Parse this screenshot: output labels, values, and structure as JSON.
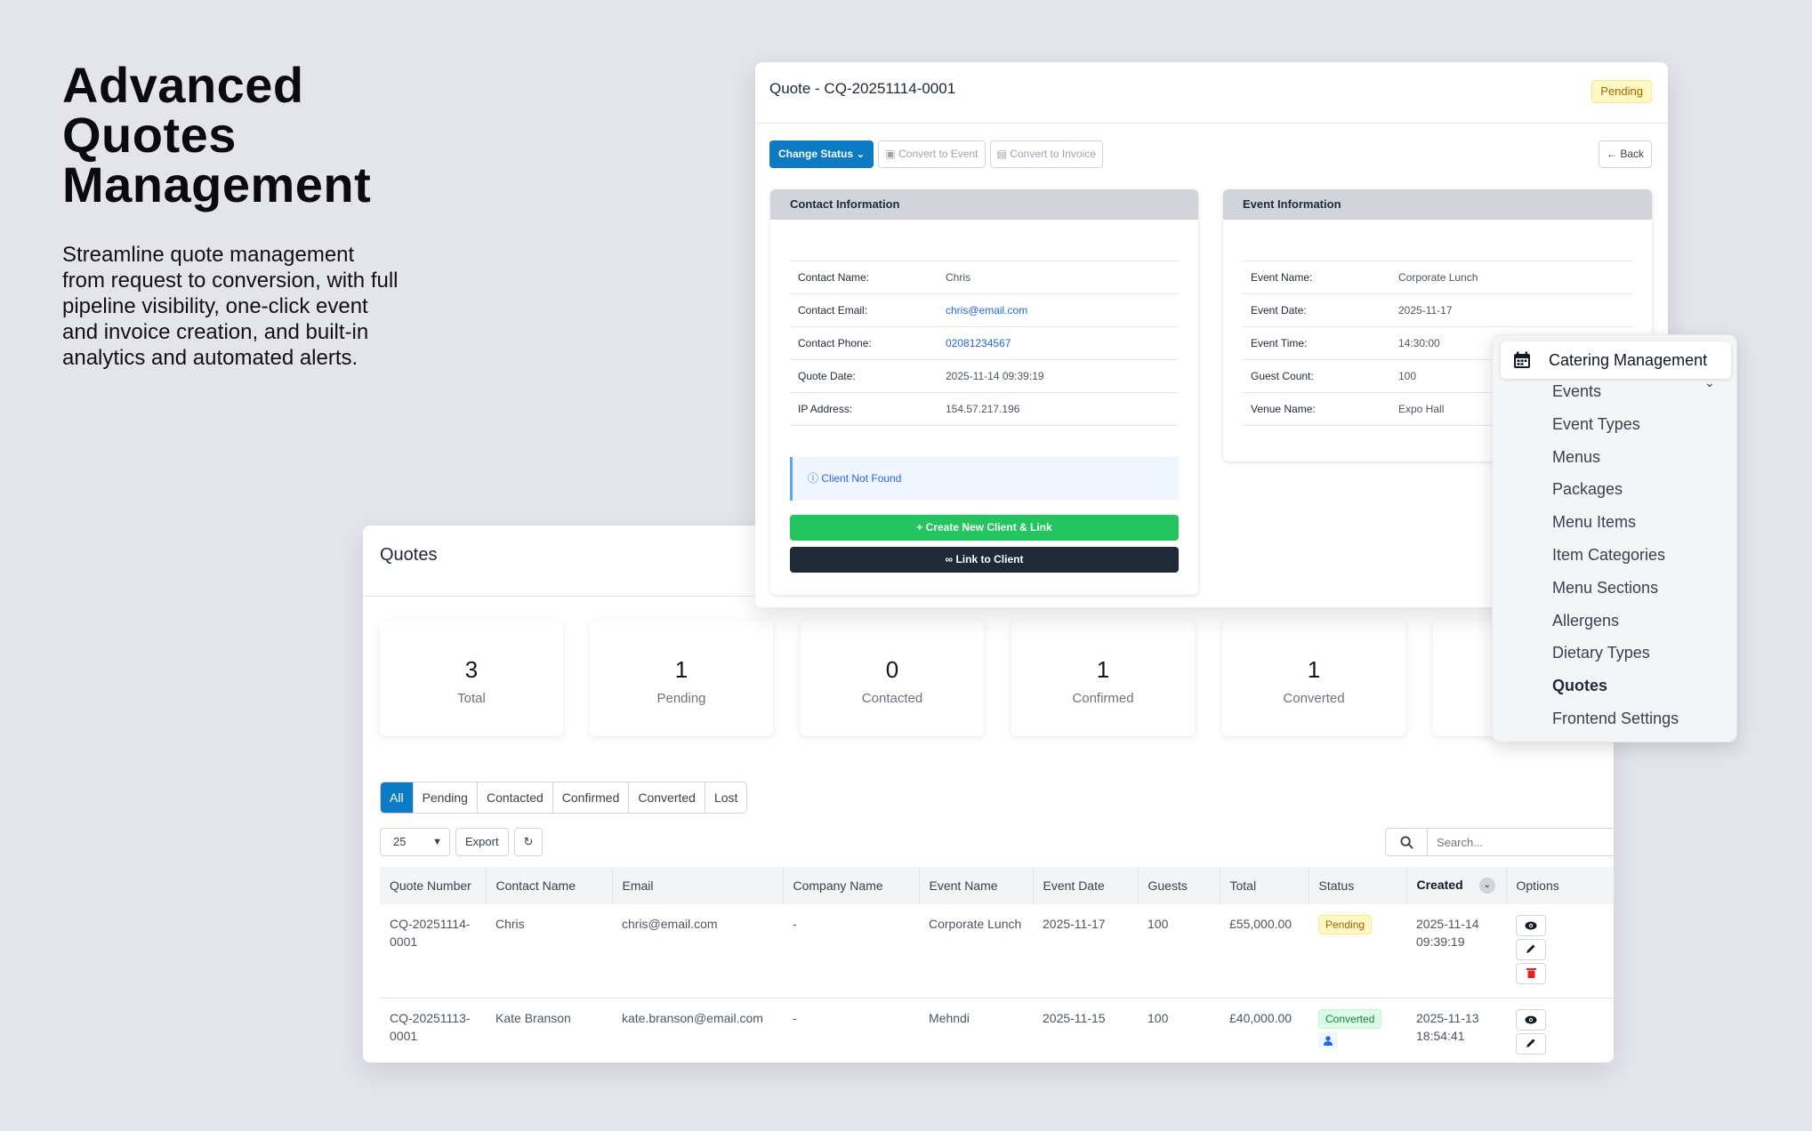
{
  "hero": {
    "title": "Advanced Quotes Management",
    "description": "Streamline quote management from request to conversion, with full pipeline visibility, one-click event and invoice creation, and built-in analytics and automated alerts."
  },
  "quotes": {
    "title": "Quotes",
    "stats": [
      {
        "value": "3",
        "label": "Total"
      },
      {
        "value": "1",
        "label": "Pending"
      },
      {
        "value": "0",
        "label": "Contacted"
      },
      {
        "value": "1",
        "label": "Confirmed"
      },
      {
        "value": "1",
        "label": "Converted"
      }
    ],
    "filters": [
      "All",
      "Pending",
      "Contacted",
      "Confirmed",
      "Converted",
      "Lost"
    ],
    "page_size": "25",
    "export_label": "Export",
    "search_placeholder": "Search...",
    "columns": [
      "Quote Number",
      "Contact Name",
      "Email",
      "Company Name",
      "Event Name",
      "Event Date",
      "Guests",
      "Total",
      "Status",
      "Created",
      "Options"
    ],
    "rows": [
      {
        "number": "CQ-20251114-0001",
        "contact": "Chris",
        "email": "chris@email.com",
        "company": "-",
        "event": "Corporate Lunch",
        "date": "2025-11-17",
        "guests": "100",
        "total": "£55,000.00",
        "status": "Pending",
        "created": "2025-11-14 09:39:19"
      },
      {
        "number": "CQ-20251113-0001",
        "contact": "Kate Branson",
        "email": "kate.branson@email.com",
        "company": "-",
        "event": "Mehndi",
        "date": "2025-11-15",
        "guests": "100",
        "total": "£40,000.00",
        "status": "Converted",
        "created": "2025-11-13 18:54:41"
      }
    ]
  },
  "detail": {
    "title": "Quote - CQ-20251114-0001",
    "status": "Pending",
    "change_status": "Change Status",
    "convert_event": "Convert to Event",
    "convert_invoice": "Convert to Invoice",
    "back": "Back",
    "contact_header": "Contact Information",
    "contact_rows": [
      {
        "k": "Contact Name:",
        "v": "Chris"
      },
      {
        "k": "Contact Email:",
        "v": "chris@email.com"
      },
      {
        "k": "Contact Phone:",
        "v": "02081234567"
      },
      {
        "k": "Quote Date:",
        "v": "2025-11-14 09:39:19"
      },
      {
        "k": "IP Address:",
        "v": "154.57.217.196"
      }
    ],
    "client_alert": "Client Not Found",
    "create_client": "Create New Client & Link",
    "link_client": "Link to Client",
    "event_header": "Event Information",
    "event_rows": [
      {
        "k": "Event Name:",
        "v": "Corporate Lunch"
      },
      {
        "k": "Event Date:",
        "v": "2025-11-17"
      },
      {
        "k": "Event Time:",
        "v": "14:30:00"
      },
      {
        "k": "Guest Count:",
        "v": "100"
      },
      {
        "k": "Venue Name:",
        "v": "Expo Hall"
      }
    ]
  },
  "menu": {
    "header": "Catering Management",
    "items": [
      "Events",
      "Event Types",
      "Menus",
      "Packages",
      "Menu Items",
      "Item Categories",
      "Menu Sections",
      "Allergens",
      "Dietary Types",
      "Quotes",
      "Frontend Settings"
    ],
    "active": "Quotes"
  },
  "colors": {
    "accent": "#0d7ac4",
    "success": "#22c55e",
    "dark": "#1f2937",
    "pending_bg": "#fef9c3",
    "converted_bg": "#dcfce7"
  }
}
